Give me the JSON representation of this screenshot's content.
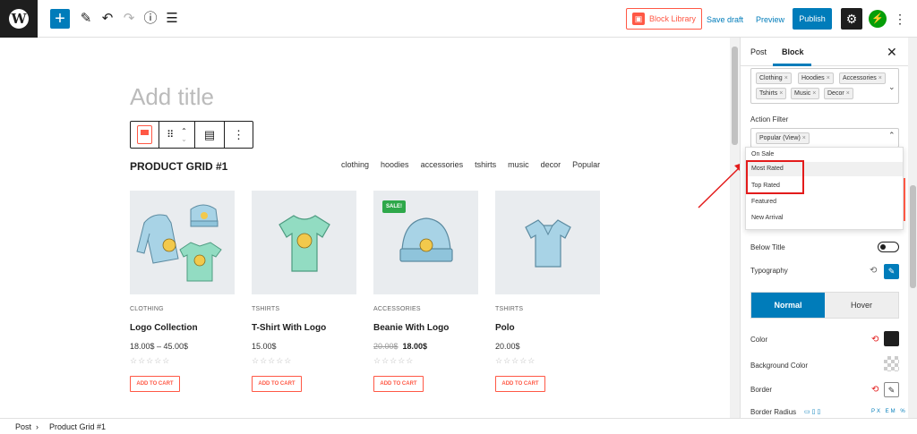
{
  "toolbar": {
    "logo_letter": "W",
    "add_symbol": "+",
    "block_library_label": "Block Library",
    "save_draft_label": "Save draft",
    "preview_label": "Preview",
    "publish_label": "Publish"
  },
  "editor": {
    "title_placeholder": "Add title",
    "grid_heading": "PRODUCT GRID #1",
    "filters": [
      "clothing",
      "hoodies",
      "accessories",
      "tshirts",
      "music",
      "decor",
      "Popular"
    ],
    "products": [
      {
        "category": "CLOTHING",
        "name": "Logo Collection",
        "price": "18.00$ – 45.00$",
        "old_price": "",
        "sale": false,
        "button": "ADD TO CART"
      },
      {
        "category": "TSHIRTS",
        "name": "T-Shirt With Logo",
        "price": "15.00$",
        "old_price": "",
        "sale": false,
        "button": "ADD TO CART"
      },
      {
        "category": "ACCESSORIES",
        "name": "Beanie With Logo",
        "price": "18.00$",
        "old_price": "20.00$",
        "sale": true,
        "sale_label": "SALE!",
        "button": "ADD TO CART"
      },
      {
        "category": "TSHIRTS",
        "name": "Polo",
        "price": "20.00$",
        "old_price": "",
        "sale": false,
        "button": "ADD TO CART"
      }
    ]
  },
  "sidebar": {
    "tab_post": "Post",
    "tab_block": "Block",
    "category_tags": [
      "Clothing",
      "Hoodies",
      "Accessories",
      "Tshirts",
      "Music",
      "Decor"
    ],
    "action_filter_label": "Action Filter",
    "action_filter_selected": "Popular (View)",
    "action_filter_options": [
      "On Sale",
      "Most Rated",
      "Top Rated",
      "Featured",
      "New Arrival"
    ],
    "below_title_label": "Below Title",
    "typography_label": "Typography",
    "state_normal": "Normal",
    "state_hover": "Hover",
    "color_label": "Color",
    "bg_color_label": "Background Color",
    "border_label": "Border",
    "border_radius_label": "Border Radius",
    "units": "PX EM %",
    "color_value": "#1e1e1e"
  },
  "footer": {
    "crumb_post": "Post",
    "crumb_block": "Product Grid #1"
  },
  "colors": {
    "accent": "#007cba",
    "brand": "#ff5845",
    "highlight": "#e31b1b"
  }
}
